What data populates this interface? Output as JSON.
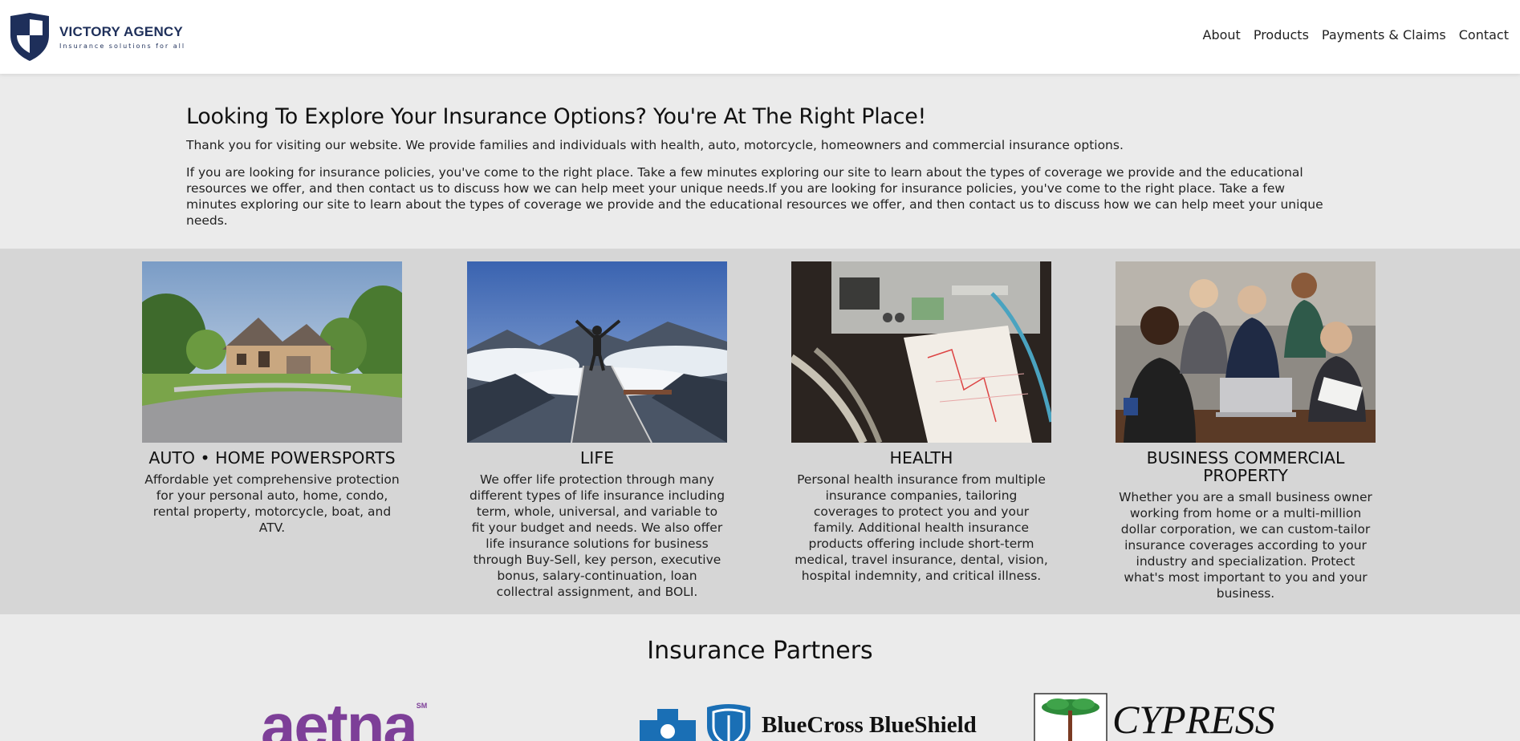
{
  "brand": {
    "name": "VICTORY AGENCY",
    "tagline": "Insurance solutions for all",
    "colors": {
      "navy": "#1e2f5a",
      "shield_light": "#ffffff"
    }
  },
  "nav": {
    "items": [
      "About",
      "Products",
      "Payments & Claims",
      "Contact"
    ]
  },
  "intro": {
    "heading": "Looking To Explore Your Insurance Options? You're At The Right Place!",
    "paragraph1": "Thank you for visiting our website. We provide families and individuals with health, auto, motorcycle, homeowners and commercial insurance options.",
    "paragraph2": "If you are looking for insurance policies, you've come to the right place. Take a few minutes exploring our site to learn about the types of coverage we provide and the educational resources we offer, and then contact us to discuss how we can help meet your unique needs.If you are looking for insurance policies, you've come to the right place. Take a few minutes exploring our site to learn about the types of coverage we provide and the educational resources we offer, and then contact us to discuss how we can help meet your unique needs."
  },
  "products": [
    {
      "title": "AUTO • HOME POWERSPORTS",
      "image": "house-photo",
      "description": "Affordable yet comprehensive protection for your personal auto, home, condo, rental property, motorcycle, boat, and ATV."
    },
    {
      "title": "LIFE",
      "image": "mountain-person-photo",
      "description": "We offer life protection through many different types of life insurance including term, whole, universal, and variable to fit your budget and needs. We also offer life insurance solutions for business through Buy-Sell, key person, executive bonus, salary-continuation, loan collectral assignment, and BOLI."
    },
    {
      "title": "HEALTH",
      "image": "medical-monitor-photo",
      "description": "Personal health insurance from multiple insurance companies, tailoring coverages to protect you and your family. Additional health insurance products offering include short-term medical, travel insurance, dental, vision, hospital indemnity, and critical illness."
    },
    {
      "title": "BUSINESS COMMERCIAL PROPERTY",
      "image": "business-meeting-photo",
      "description": "Whether you are a small business owner working from home or a multi-million dollar corporation, we can custom-tailor insurance coverages according to your industry and specialization. Protect what's most important to you and your business."
    }
  ],
  "partners": {
    "heading": "Insurance Partners",
    "logos": [
      {
        "name": "aetna",
        "mark": "SM",
        "color": "#7d3f98"
      },
      {
        "name": "BlueCross BlueShield",
        "color": "#1a6fb5"
      },
      {
        "name": "CYPRESS",
        "color": "#2e8b3a"
      }
    ]
  }
}
